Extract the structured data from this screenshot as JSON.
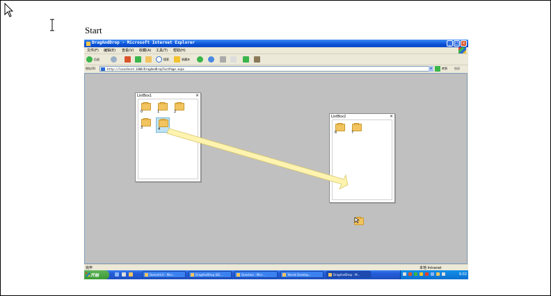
{
  "heading": "Start",
  "window": {
    "title": "DragAndDrop - Microsoft Internet Explorer",
    "menu": [
      "文件(F)",
      "编辑(E)",
      "查看(V)",
      "收藏(A)",
      "工具(T)",
      "帮助(H)"
    ],
    "toolbar": {
      "back_label": "后退",
      "search_label": "搜索",
      "favorites_label": "收藏夹"
    },
    "address": {
      "label": "地址(D)",
      "value": "http://localhost:1408/DragAndDropTestPage.aspx",
      "go_label": "转到",
      "links_label": "链接"
    }
  },
  "listbox1": {
    "title": "ListBox1",
    "close": "×",
    "items": [
      "0",
      "1",
      "2",
      "3",
      "4"
    ],
    "selected": "4"
  },
  "listbox2": {
    "title": "ListBox2",
    "close": "×",
    "items": [
      "6",
      "7"
    ]
  },
  "status": {
    "left": "完毕",
    "zone": "本地 Intranet"
  },
  "taskbar": {
    "start_label": "开始",
    "tasks": [
      "DemoAll.0 - Micr...",
      "DragAndDrop (EE...",
      "Question - Micr...",
      "Telerik Desktop...",
      "DragAndDrop - M..."
    ],
    "clock": "9:02"
  },
  "colors": {
    "content_bg": "#c0c0c0",
    "titlebar": "#0a52d8",
    "arrow": "#fff3b0"
  }
}
